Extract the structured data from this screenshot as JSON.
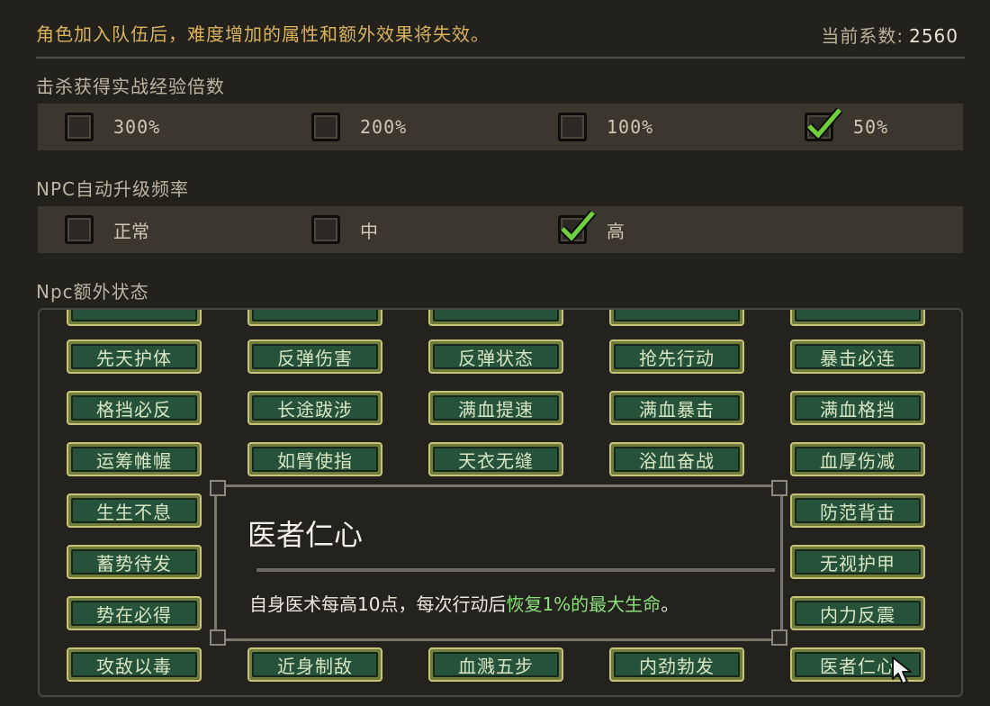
{
  "header": {
    "notice": "角色加入队伍后，难度增加的属性和额外效果将失效。",
    "coef_label": "当前系数:",
    "coef_value": "2560"
  },
  "exp_multiplier": {
    "title": "击杀获得实战经验倍数",
    "options": [
      {
        "label": "300%",
        "checked": false
      },
      {
        "label": "200%",
        "checked": false
      },
      {
        "label": "100%",
        "checked": false
      },
      {
        "label": "50%",
        "checked": true
      }
    ]
  },
  "npc_levelup": {
    "title": "NPC自动升级频率",
    "options": [
      {
        "label": "正常",
        "checked": false
      },
      {
        "label": "中",
        "checked": false
      },
      {
        "label": "高",
        "checked": true
      }
    ]
  },
  "npc_extra": {
    "title": "Npc额外状态",
    "rows": [
      [
        "先天护体",
        "反弹伤害",
        "反弹状态",
        "抢先行动",
        "暴击必连"
      ],
      [
        "格挡必反",
        "长途跋涉",
        "满血提速",
        "满血暴击",
        "满血格挡"
      ],
      [
        "运筹帷幄",
        "如臂使指",
        "天衣无缝",
        "浴血奋战",
        "血厚伤减"
      ],
      [
        "生生不息",
        "",
        "",
        "",
        "防范背击"
      ],
      [
        "蓄势待发",
        "",
        "",
        "",
        "无视护甲"
      ],
      [
        "势在必得",
        "",
        "",
        "",
        "内力反震"
      ],
      [
        "攻敌以毒",
        "近身制敌",
        "血溅五步",
        "内劲勃发",
        "医者仁心"
      ]
    ]
  },
  "tooltip": {
    "title": "医者仁心",
    "desc_prefix": "自身医术每高10点，每次行动后",
    "desc_highlight": "恢复1%的最大生命",
    "desc_suffix": "。"
  },
  "colors": {
    "gold_text": "#d9b25e",
    "check_green": "#6fcf3f",
    "highlight_green": "#8be07a",
    "tag_fill": "#27523a"
  }
}
